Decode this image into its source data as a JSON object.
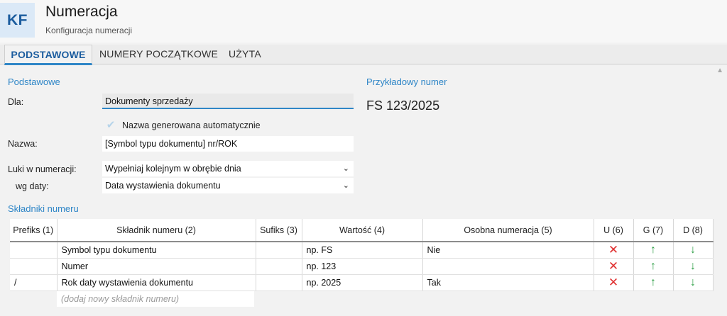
{
  "header": {
    "logo": "KF",
    "title": "Numeracja",
    "subtitle": "Konfiguracja numeracji"
  },
  "tabs": [
    {
      "label": "PODSTAWOWE",
      "active": true
    },
    {
      "label": "NUMERY POCZĄTKOWE",
      "active": false
    },
    {
      "label": "UŻYTA",
      "active": false
    }
  ],
  "basic": {
    "section_title": "Podstawowe",
    "dla_label": "Dla:",
    "dla_value": "Dokumenty sprzedaży",
    "auto_name_label": "Nazwa generowana automatycznie",
    "auto_name_checked": true,
    "nazwa_label": "Nazwa:",
    "nazwa_value": "[Symbol typu dokumentu] nr/ROK",
    "luki_label": "Luki w numeracji:",
    "luki_value": "Wypełniaj kolejnym w obrębie dnia",
    "wg_daty_label": "wg daty:",
    "wg_daty_value": "Data wystawienia dokumentu"
  },
  "example": {
    "section_title": "Przykładowy numer",
    "value": "FS 123/2025"
  },
  "components": {
    "section_title": "Składniki numeru",
    "columns": [
      "Prefiks (1)",
      "Składnik numeru (2)",
      "Sufiks (3)",
      "Wartość (4)",
      "Osobna numeracja (5)",
      "U (6)",
      "G (7)",
      "D (8)"
    ],
    "rows": [
      {
        "prefix": "",
        "component": "Symbol typu dokumentu",
        "suffix": "",
        "value": "np. FS",
        "separate": "Nie"
      },
      {
        "prefix": "",
        "component": "Numer",
        "suffix": "",
        "value": "np. 123",
        "separate": ""
      },
      {
        "prefix": "/",
        "component": "Rok daty wystawienia dokumentu",
        "suffix": "",
        "value": "np. 2025",
        "separate": "Tak"
      }
    ],
    "add_placeholder": "(dodaj nowy składnik numeru)",
    "icons": {
      "delete": "close-x-icon",
      "up": "arrow-up-icon",
      "down": "arrow-down-icon"
    },
    "colors": {
      "delete": "#e03131",
      "arrows": "#2c9e44"
    }
  },
  "colors": {
    "accent": "#2f86c7"
  }
}
